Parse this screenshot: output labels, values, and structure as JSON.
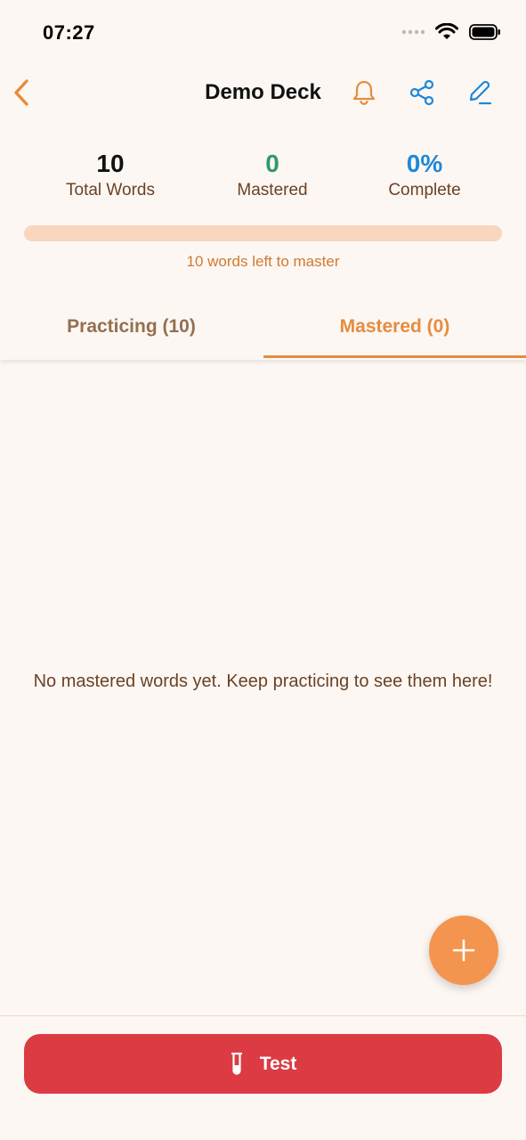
{
  "status_bar": {
    "time": "07:27"
  },
  "header": {
    "title": "Demo Deck"
  },
  "stats": {
    "total_words": {
      "value": "10",
      "label": "Total Words"
    },
    "mastered": {
      "value": "0",
      "label": "Mastered"
    },
    "complete": {
      "value": "0%",
      "label": "Complete"
    }
  },
  "progress": {
    "fraction": 0,
    "caption": "10 words left to master"
  },
  "tabs": [
    {
      "label": "Practicing (10)",
      "selected": false
    },
    {
      "label": "Mastered (0)",
      "selected": true
    }
  ],
  "empty_state": {
    "message": "No mastered words yet. Keep practicing to see them here!"
  },
  "fab": {
    "icon": "plus-icon"
  },
  "footer": {
    "test_label": "Test",
    "test_icon": "test-tube-icon"
  },
  "colors": {
    "accent_orange": "#e58c3f",
    "mastered_green": "#2e9a6a",
    "complete_blue": "#1e88d8",
    "test_red": "#dc3b44",
    "background": "#fdf7f3"
  }
}
